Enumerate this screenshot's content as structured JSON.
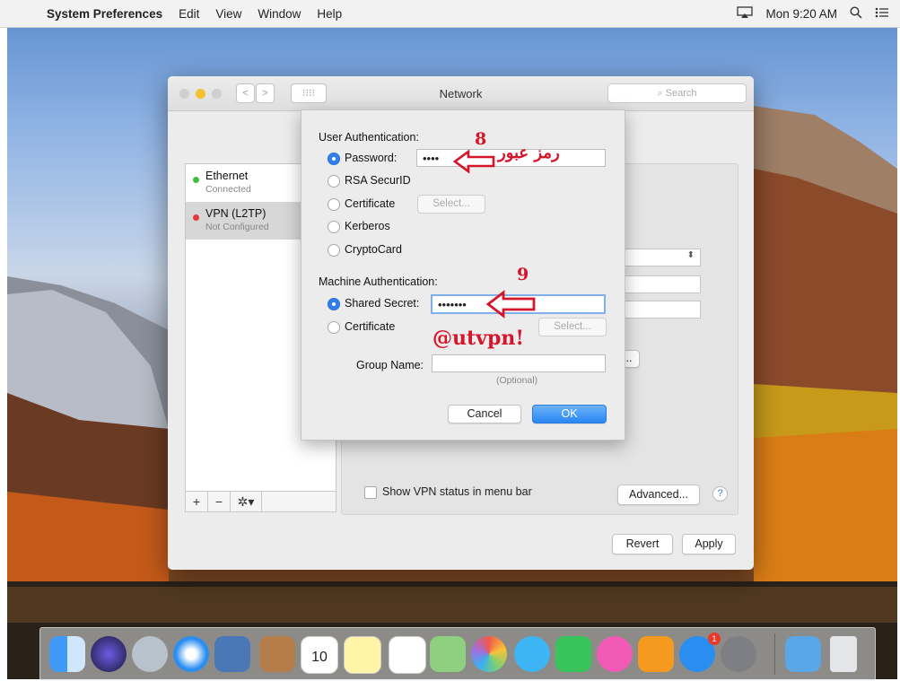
{
  "menubar": {
    "apple": "",
    "app": "System Preferences",
    "items": [
      "Edit",
      "View",
      "Window",
      "Help"
    ],
    "clock": "Mon 9:20 AM"
  },
  "window": {
    "title": "Network",
    "search_placeholder": "Search",
    "nav_back": "<",
    "nav_forward": ">",
    "grid": "⁝⁝⁝⁝"
  },
  "services": [
    {
      "name": "Ethernet",
      "status": "Connected",
      "color": "#3fbf3f"
    },
    {
      "name": "VPN (L2TP)",
      "status": "Not Configured",
      "color": "#e03a3a"
    }
  ],
  "sidebar_toolbar": {
    "add": "+",
    "remove": "−",
    "gear": "✲▾"
  },
  "pane": {
    "show_vpn_label": "Show VPN status in menu bar",
    "advanced_label": "Advanced...",
    "help": "?",
    "revert_label": "Revert",
    "apply_label": "Apply"
  },
  "sheet": {
    "user_auth_title": "User Authentication:",
    "user_options": [
      {
        "label": "Password:",
        "selected": true
      },
      {
        "label": "RSA SecurID",
        "selected": false
      },
      {
        "label": "Certificate",
        "selected": false
      },
      {
        "label": "Kerberos",
        "selected": false
      },
      {
        "label": "CryptoCard",
        "selected": false
      }
    ],
    "password_value": "••••",
    "select_label": "Select...",
    "machine_auth_title": "Machine Authentication:",
    "machine_options": [
      {
        "label": "Shared Secret:",
        "selected": true
      },
      {
        "label": "Certificate",
        "selected": false
      }
    ],
    "shared_secret_value": "•••••••",
    "group_name_label": "Group Name:",
    "group_name_value": "",
    "optional_note": "(Optional)",
    "cancel_label": "Cancel",
    "ok_label": "OK"
  },
  "annotations": {
    "step8": "8",
    "step9": "9",
    "arabic": "رمز عبور",
    "handle": "@utvpn!",
    "color": "#d6152a"
  }
}
